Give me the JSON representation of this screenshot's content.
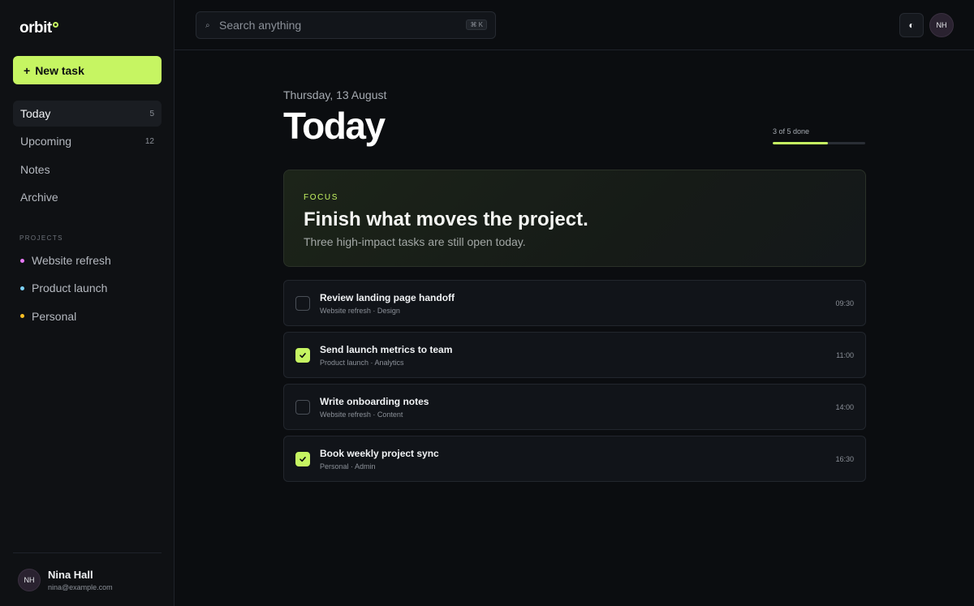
{
  "app": {
    "logo": "orbit",
    "accent_color": "#c6f562"
  },
  "sidebar": {
    "new_task_label": "New task",
    "nav": [
      {
        "label": "Today",
        "count": "5",
        "active": true
      },
      {
        "label": "Upcoming",
        "count": "12",
        "active": false
      },
      {
        "label": "Notes",
        "count": "",
        "active": false
      },
      {
        "label": "Archive",
        "count": "",
        "active": false
      }
    ],
    "projects_label": "PROJECTS",
    "projects": [
      {
        "label": "Website refresh",
        "color": "#e879f9"
      },
      {
        "label": "Product launch",
        "color": "#7dd3fc"
      },
      {
        "label": "Personal",
        "color": "#fbbf24"
      }
    ],
    "user": {
      "initials": "NH",
      "name": "Nina Hall",
      "email": "nina@example.com"
    }
  },
  "topbar": {
    "search_placeholder": "Search anything",
    "search_shortcut": "⌘ K",
    "search_icon": "search-icon",
    "theme_icon": "contrast-icon",
    "avatar_initials": "NH"
  },
  "main": {
    "date": "Thursday, 13 August",
    "title": "Today",
    "progress_text": "3 of 5 done",
    "progress_done": 3,
    "progress_total": 5,
    "focus": {
      "label": "FOCUS",
      "title": "Finish what moves the project.",
      "subtitle": "Three high-impact tasks are still open today."
    },
    "tasks": [
      {
        "title": "Review landing page handoff",
        "meta": "Website refresh · Design",
        "time": "09:30",
        "done": false
      },
      {
        "title": "Send launch metrics to team",
        "meta": "Product launch · Analytics",
        "time": "11:00",
        "done": true
      },
      {
        "title": "Write onboarding notes",
        "meta": "Website refresh · Content",
        "time": "14:00",
        "done": false
      },
      {
        "title": "Book weekly project sync",
        "meta": "Personal · Admin",
        "time": "16:30",
        "done": true
      }
    ]
  }
}
